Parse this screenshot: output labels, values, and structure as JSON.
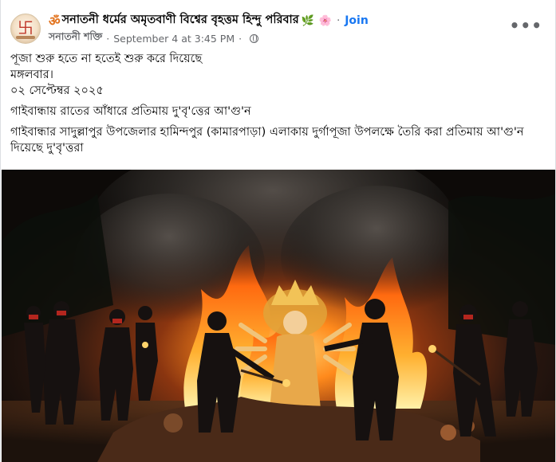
{
  "post": {
    "group_name": "সনাতনী ধর্মের অমৃতবাণী বিশ্বের বৃহত্তম হিন্দু পরিবার",
    "om_symbol": "ॐ",
    "leaf_emoji": "🌿",
    "flower_emoji": "🌸",
    "join_label": "Join",
    "author": "সনাতনী শক্তি",
    "timestamp": "September 4 at 3:45 PM",
    "more_icon": "•••",
    "text_lines": [
      "পূজা শুরু হতে না হতেই শুরু করে দিয়েছে",
      "মঙ্গলবার।",
      "০২ সেপ্টেম্বর ২০২৫",
      "গাইবান্ধায় রাতের আঁধারে প্রতিমায় দু'বৃ'ত্তের আ'গু'ন",
      "গাইবান্ধার সাদুল্লাপুর উপজেলার হামিন্দপুর (কামারপাড়া) এলাকায় দুর্গাপূজা উপলক্ষে তৈরি করা প্রতিমায় আ'গু'ন দিয়েছে দু'বৃ'ত্তরা"
    ]
  },
  "icons": {
    "avatar_glyph": "卐",
    "globe": "globe-icon"
  },
  "colors": {
    "accent": "#1877f2",
    "text": "#050505",
    "secondary": "#65676b",
    "fire": "#ff8a1c"
  }
}
